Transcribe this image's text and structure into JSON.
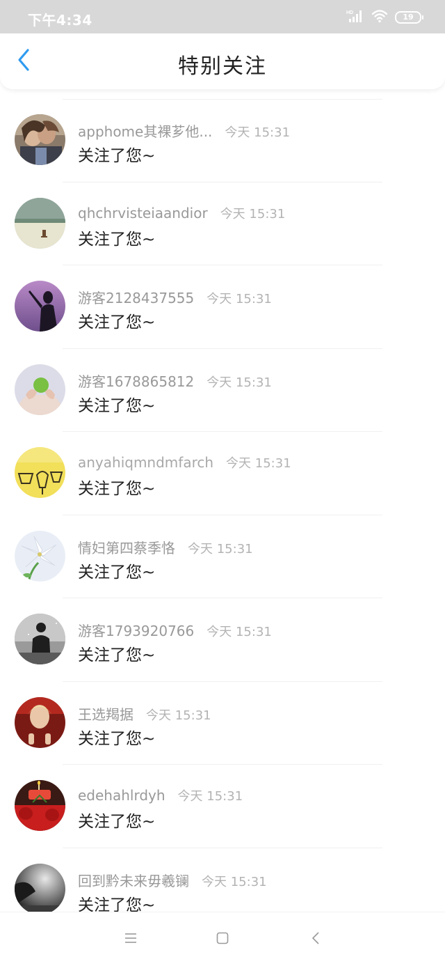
{
  "status_bar": {
    "time": "下午4:34",
    "battery_level": "19",
    "icons": [
      "hd-signal-icon",
      "wifi-icon",
      "battery-icon"
    ]
  },
  "header": {
    "title": "特别关注",
    "back_icon": "chevron-left-icon",
    "accent_color": "#2f9bf0"
  },
  "list": {
    "items": [
      {
        "name": "apphome其裸芗他...",
        "time": "今天 15:31",
        "message": "关注了您~"
      },
      {
        "name": "qhchrvisteiaandior",
        "time": "今天 15:31",
        "message": "关注了您~"
      },
      {
        "name": "游客2128437555",
        "time": "今天 15:31",
        "message": "关注了您~"
      },
      {
        "name": "游客1678865812",
        "time": "今天 15:31",
        "message": "关注了您~"
      },
      {
        "name": "anyahiqmndmfarch",
        "time": "今天 15:31",
        "message": "关注了您~"
      },
      {
        "name": "情妇第四蔡季恪",
        "time": "今天 15:31",
        "message": "关注了您~"
      },
      {
        "name": "游客1793920766",
        "time": "今天 15:31",
        "message": "关注了您~"
      },
      {
        "name": "王选羯据",
        "time": "今天 15:31",
        "message": "关注了您~"
      },
      {
        "name": "edehahlrdyh",
        "time": "今天 15:31",
        "message": "关注了您~"
      },
      {
        "name": "回到黔未来毋羲镧",
        "time": "今天 15:31",
        "message": "关注了您~"
      }
    ]
  },
  "nav_bar": {
    "icons": [
      "menu-icon",
      "home-square-icon",
      "back-triangle-icon"
    ]
  }
}
